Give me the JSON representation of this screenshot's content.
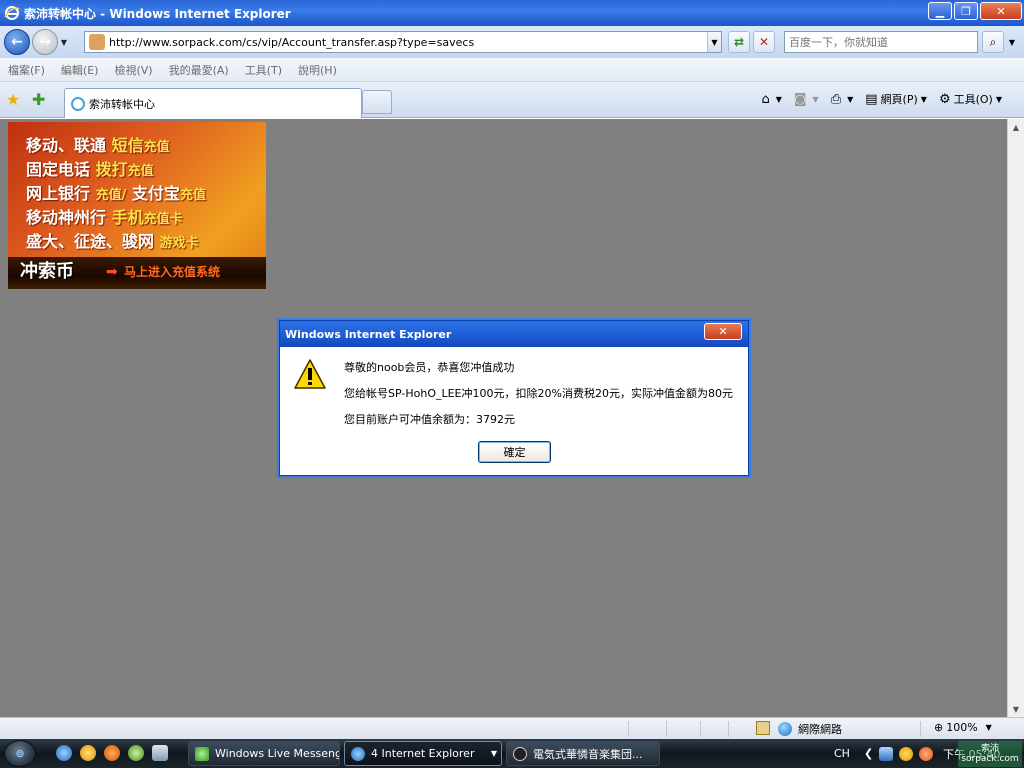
{
  "window": {
    "title": "索沛转帐中心 - Windows Internet Explorer",
    "minimize_label": "▁",
    "maximize_label": "❐",
    "close_label": "✕"
  },
  "address": {
    "url": "http://www.sorpack.com/cs/vip/Account_transfer.asp?type=savecs",
    "search_placeholder": "百度一下，你就知道"
  },
  "menu": {
    "items": [
      "檔案(F)",
      "編輯(E)",
      "檢視(V)",
      "我的最愛(A)",
      "工具(T)",
      "說明(H)"
    ]
  },
  "tabs": {
    "active_label": "索沛转帐中心"
  },
  "commands": {
    "page_label": "網頁(P)",
    "tools_label": "工具(O)"
  },
  "banner": {
    "line1_a": "移动、联通",
    "line1_b": "短信",
    "line1_c": "充值",
    "line2_a": "固定电话",
    "line2_b": "拨打",
    "line2_c": "充值",
    "line3_a": "网上银行",
    "line3_b": "充值/",
    "line3_c": "支付宝",
    "line3_d": "充值",
    "line4_a": "移动神州行",
    "line4_b": "手机",
    "line4_c": "充值卡",
    "line5_a": "盛大、征途、骏网",
    "line5_b": "游戏卡",
    "coin_label": "冲索币",
    "enter_label": "马上进入充值系统"
  },
  "dialog": {
    "title": "Windows Internet Explorer",
    "close_label": "✕",
    "line1": "尊敬的noob会员，恭喜您冲值成功",
    "line2": "您给帐号SP-HohO_LEE冲100元，扣除20%消费税20元，实际冲值金额为80元",
    "line3": "您目前账户可冲值余额为：3792元",
    "ok_label": "確定"
  },
  "status": {
    "zone_label": "網際網路",
    "zoom_label": "100%"
  },
  "taskbar": {
    "messenger_label": "Windows Live Messenger",
    "ie_label": "4 Internet Explorer",
    "music_label": "電気式華憐音楽集団...",
    "lang_label": "CH",
    "clock_label": "下午 05:40",
    "watermark_line1": "索沛",
    "watermark_line2": "sorpack.com"
  }
}
